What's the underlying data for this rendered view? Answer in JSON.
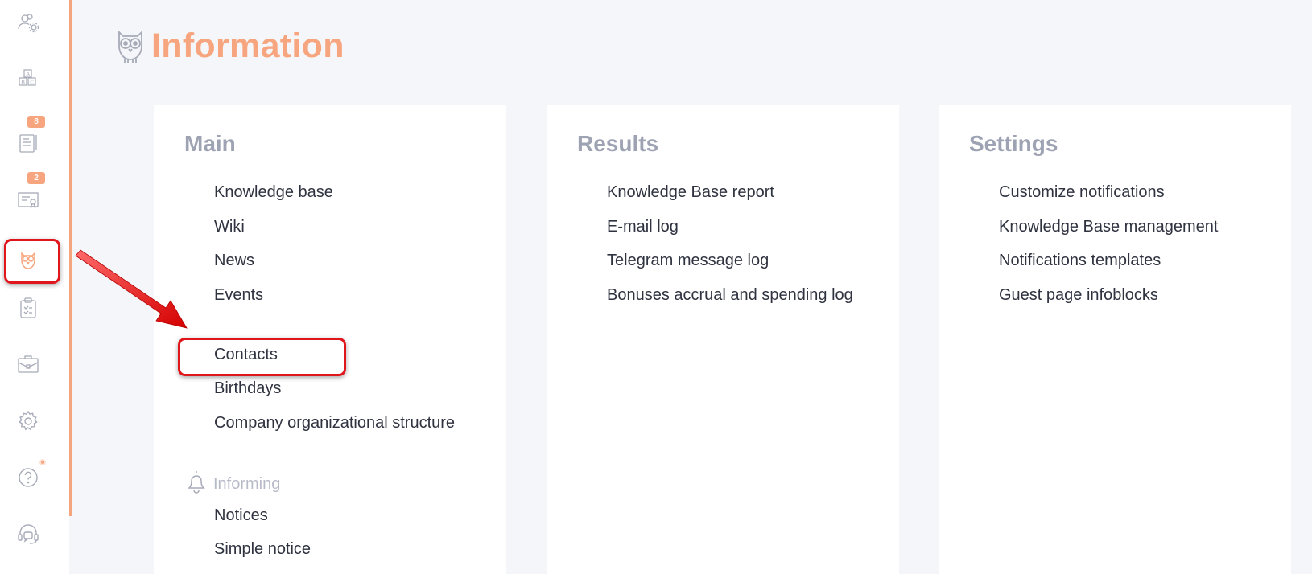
{
  "app": {
    "title": "Information",
    "accent_color": "#f7a57e",
    "highlight_color": "#e0161d"
  },
  "sidebar": {
    "items": [
      {
        "icon": "users-settings-icon"
      },
      {
        "icon": "abc-blocks-icon"
      },
      {
        "icon": "notebook-icon",
        "badge": "8"
      },
      {
        "icon": "certificate-icon",
        "badge": "2"
      },
      {
        "icon": "owl-icon",
        "active": true
      },
      {
        "icon": "clipboard-icon"
      },
      {
        "icon": "briefcase-icon"
      },
      {
        "icon": "gear-icon"
      },
      {
        "icon": "help-icon",
        "notification_dot": true
      },
      {
        "icon": "support-chat-icon"
      }
    ]
  },
  "cards": {
    "main": {
      "title": "Main",
      "links": [
        "Knowledge base",
        "Wiki",
        "News",
        "Events",
        "Contacts",
        "Birthdays",
        "Company organizational structure"
      ],
      "section": {
        "icon": "bell-icon",
        "label": "Informing",
        "links": [
          "Notices",
          "Simple notice"
        ]
      }
    },
    "results": {
      "title": "Results",
      "links": [
        "Knowledge Base report",
        "E-mail log",
        "Telegram message log",
        "Bonuses accrual and spending log"
      ]
    },
    "settings": {
      "title": "Settings",
      "links": [
        "Customize notifications",
        "Knowledge Base management",
        "Notifications templates",
        "Guest page infoblocks"
      ]
    }
  }
}
